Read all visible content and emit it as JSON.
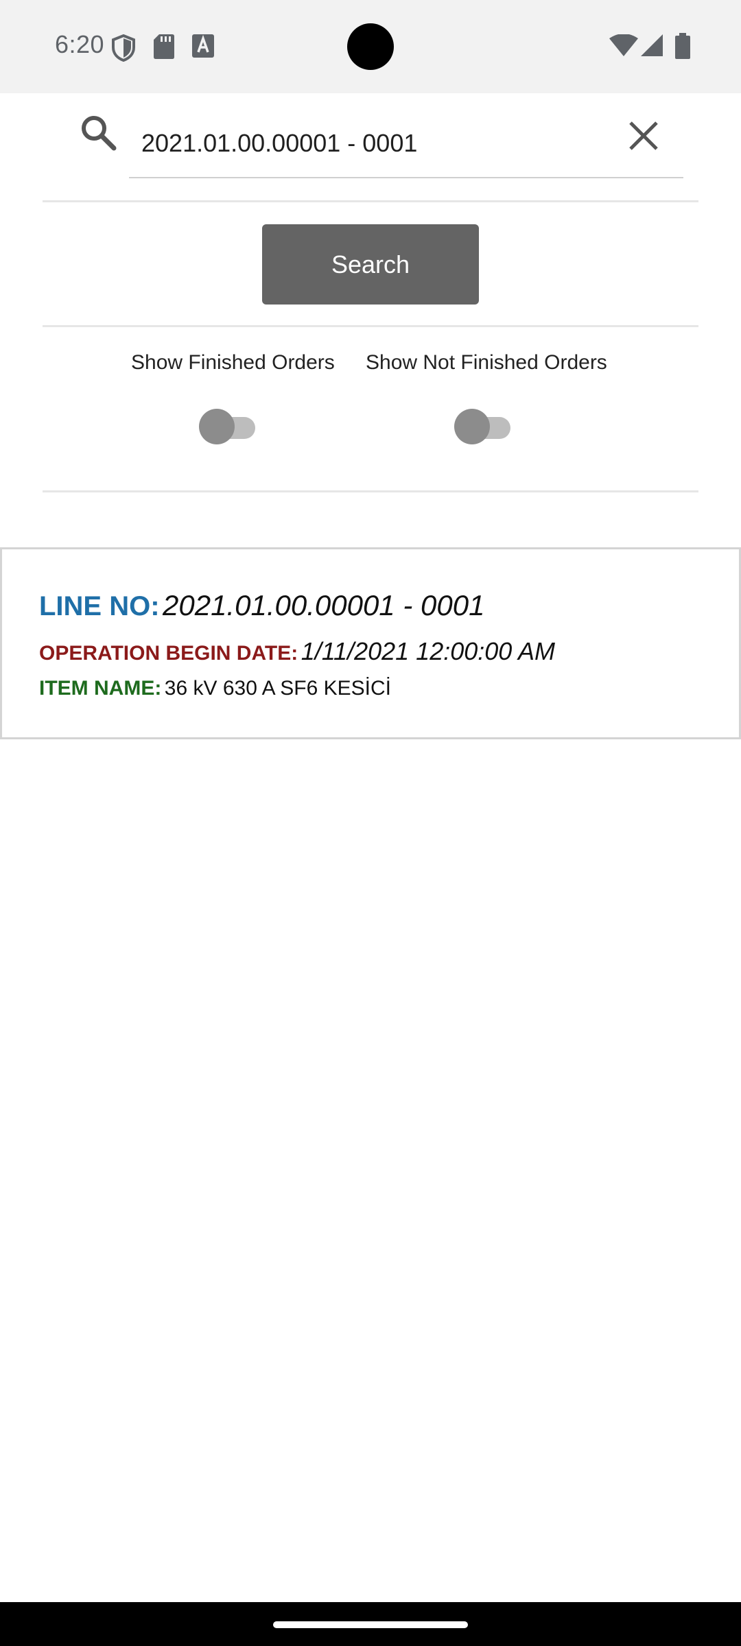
{
  "status_bar": {
    "time": "6:20",
    "left_icons": [
      "shield-icon",
      "sd-card-icon",
      "keyboard-a-icon"
    ],
    "right_icons": [
      "wifi-icon",
      "cell-signal-icon",
      "battery-icon"
    ]
  },
  "search": {
    "value": "2021.01.00.00001 - 0001",
    "button_label": "Search"
  },
  "filters": {
    "finished_label": "Show Finished Orders",
    "finished_on": false,
    "not_finished_label": "Show Not Finished Orders",
    "not_finished_on": false
  },
  "results": [
    {
      "line_no_label": "LINE NO:",
      "line_no": "2021.01.00.00001 - 0001",
      "op_date_label": "OPERATION BEGIN DATE:",
      "op_date": "1/11/2021 12:00:00 AM",
      "item_name_label": "ITEM NAME:",
      "item_name": "36 kV 630 A SF6 KESİCİ"
    }
  ],
  "colors": {
    "line_no_label": "#1f6fa8",
    "op_date_label": "#8b1a1a",
    "item_name_label": "#1e6b1e",
    "search_button": "#646464"
  }
}
